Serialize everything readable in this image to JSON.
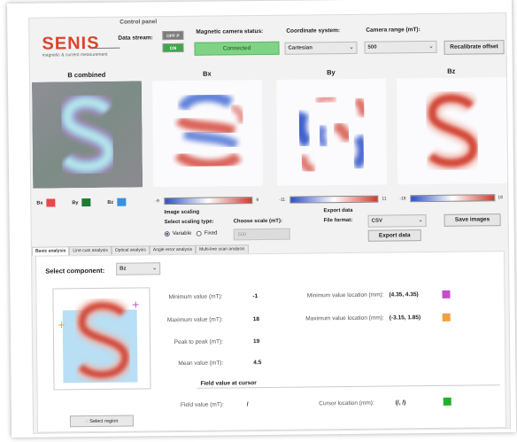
{
  "header": {
    "logo_text": "SENIS",
    "logo_subtitle": "magnetic & current measurement",
    "control_panel_label": "Control panel",
    "data_stream_label": "Data stream:",
    "stream_off": "OFF P",
    "stream_on": "ON",
    "magnetic_status_label": "Magnetic camera status:",
    "magnetic_status_value": "Connected",
    "coordinate_label": "Coordinate system:",
    "coordinate_value": "Cartesian",
    "range_label": "Camera range (mT):",
    "range_value": "500",
    "recalibrate_label": "Recalibrate offset"
  },
  "maps": {
    "titles": [
      "B combined",
      "Bx",
      "By",
      "Bz"
    ],
    "legend": [
      {
        "label": "Bx",
        "color": "#e8474b"
      },
      {
        "label": "By",
        "color": "#1f7a37"
      },
      {
        "label": "Bz",
        "color": "#3a8fe0"
      }
    ],
    "colorbars": [
      {
        "min": "-9",
        "max": "9"
      },
      {
        "min": "-11",
        "max": "11"
      },
      {
        "min": "-18",
        "max": "18"
      }
    ]
  },
  "scaling": {
    "title": "Image scaling",
    "type_label": "Select scaling type:",
    "option_variable": "Variable",
    "option_fixed": "Fixed",
    "scale_label": "Choose scale (mT):",
    "scale_value": "500"
  },
  "export": {
    "title": "Export data",
    "format_label": "File format:",
    "format_value": "CSV",
    "export_button": "Export data",
    "save_images_button": "Save images"
  },
  "tabs": [
    "Basic analysis",
    "Line cuts analysis",
    "Optical analysis",
    "Angle error analysis",
    "Multi-line scan analysis"
  ],
  "analysis": {
    "component_label": "Select component:",
    "component_value": "Bz",
    "select_region_label": "Select region",
    "stats": [
      {
        "label": "Minimum value (mT):",
        "value": "-1"
      },
      {
        "label": "Maximum value (mT):",
        "value": "18"
      },
      {
        "label": "Peak to peak (mT):",
        "value": "19"
      },
      {
        "label": "Mean value (mT):",
        "value": "4.5"
      }
    ],
    "locations": [
      {
        "label": "Minimum value location (mm):",
        "value": "(4.35, 4.35)",
        "color": "#c24fc4"
      },
      {
        "label": "Maximum value location (mm):",
        "value": "(-3.15, 1.85)",
        "color": "#f0a13a"
      }
    ],
    "cursor_title": "Field value at cursor",
    "field_label": "Field value (mT):",
    "field_value": "/",
    "cursor_loc_label": "Cursor location (mm):",
    "cursor_loc_value": "(/, /)",
    "cursor_color": "#22b02a"
  }
}
